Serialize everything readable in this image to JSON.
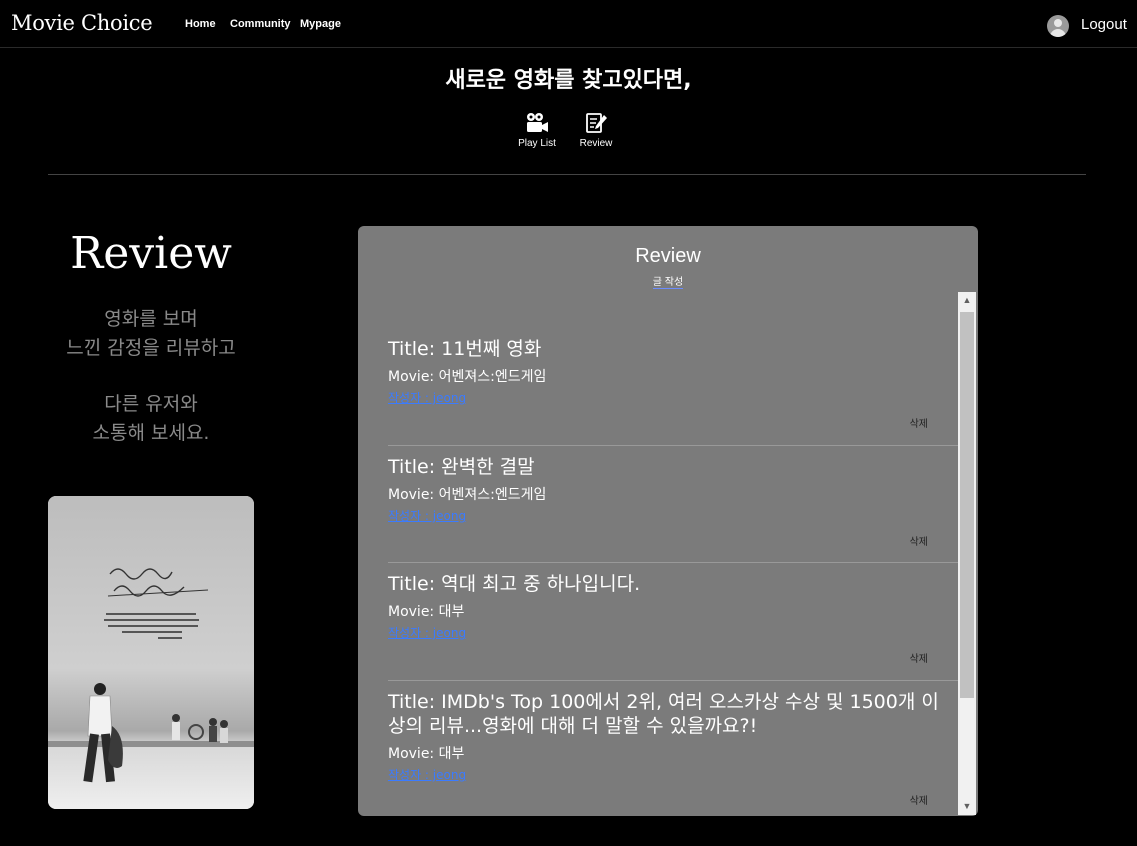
{
  "nav": {
    "brand": "Movie Choice",
    "links": [
      "Home",
      "Community",
      "Mypage"
    ],
    "logout": "Logout",
    "avatar_icon": "user-avatar-icon"
  },
  "hero": {
    "title": "새로운 영화를 찾고있다면,",
    "buttons": [
      {
        "label": "Play List",
        "icon": "movie-camera-icon"
      },
      {
        "label": "Review",
        "icon": "notepad-pen-icon"
      }
    ]
  },
  "left": {
    "title": "Review",
    "desc1_line1": "영화를 보며",
    "desc1_line2": "느낀 감정을 리뷰하고",
    "desc2_line1": "다른 유저와",
    "desc2_line2": "소통해 보세요.",
    "poster": {
      "handwriting": "스물다섯 스물하나",
      "quote": "\"Nothing lasts forever. Everything is momentary. They all flow away. And that's not always a bad thing.\"",
      "quote_by": "- Na Hee Do"
    }
  },
  "panel": {
    "title": "Review",
    "write_label": "글 작성",
    "reviews": [
      {
        "title": "Title: 11번째 영화",
        "movie": "Movie: 어벤져스:엔드게임",
        "author": "작성자 : jeong",
        "delete": "삭제"
      },
      {
        "title": "Title: 완벽한 결말",
        "movie": "Movie: 어벤져스:엔드게임",
        "author": "작성자 : jeong",
        "delete": "삭제"
      },
      {
        "title": "Title: 역대 최고 중 하나입니다.",
        "movie": "Movie: 대부",
        "author": "작성자 : jeong",
        "delete": "삭제"
      },
      {
        "title": "Title: IMDb's Top 100에서 2위, 여러 오스카상 수상 및 1500개 이상의 리뷰...영화에 대해 더 말할 수 있을까요?!",
        "movie": "Movie: 대부",
        "author": "작성자 : jeong",
        "delete": "삭제"
      }
    ]
  }
}
